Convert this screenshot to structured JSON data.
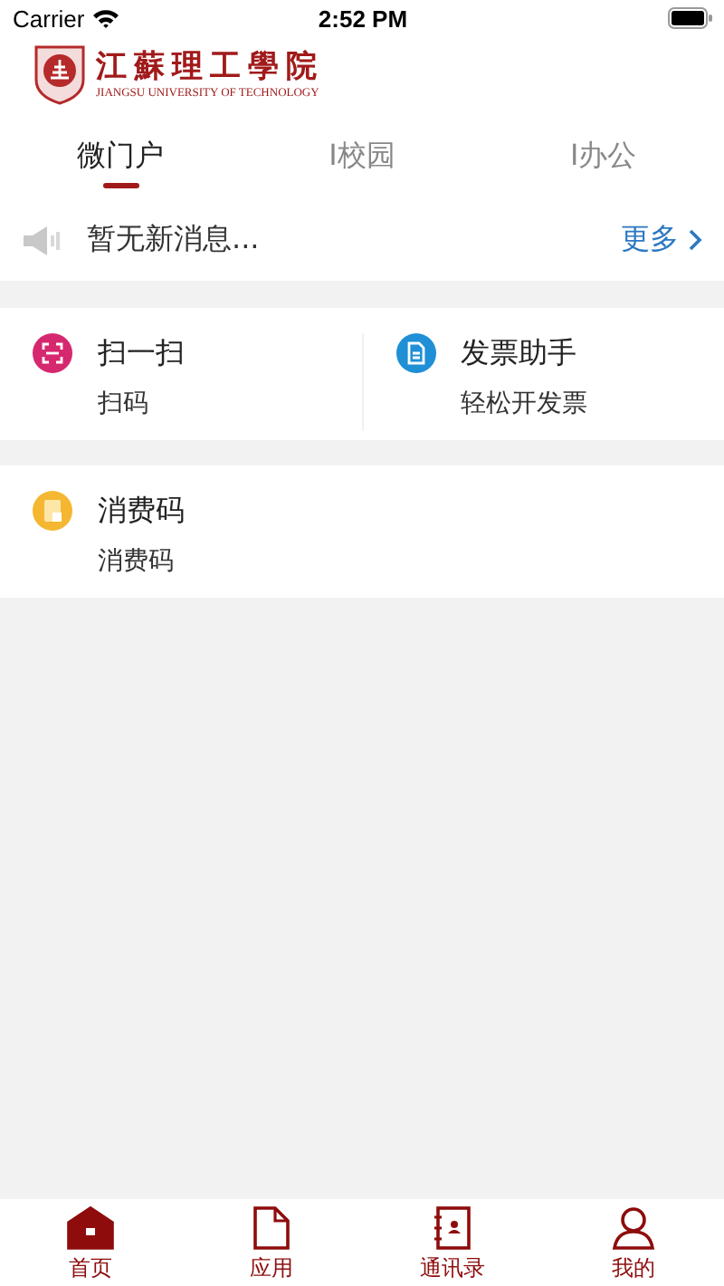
{
  "status_bar": {
    "carrier": "Carrier",
    "time": "2:52 PM"
  },
  "header": {
    "logo_name": "江蘇理工學院",
    "logo_subtitle": "JIANGSU UNIVERSITY OF TECHNOLOGY"
  },
  "tabs": [
    {
      "label": "微门户",
      "selected": true
    },
    {
      "label": "I校园",
      "selected": false
    },
    {
      "label": "I办公",
      "selected": false
    }
  ],
  "notice": {
    "text": "暂无新消息...",
    "more": "更多"
  },
  "sections": [
    {
      "items": [
        {
          "kind": "scan",
          "color": "#d6286f",
          "title": "扫一扫",
          "subtitle": "扫码"
        },
        {
          "kind": "invoice",
          "color": "#1f8fd6",
          "title": "发票助手",
          "subtitle": "轻松开发票"
        }
      ]
    },
    {
      "items": [
        {
          "kind": "payment-code",
          "color": "#f5b731",
          "title": "消费码",
          "subtitle": "消费码"
        }
      ]
    }
  ],
  "tab_bar": [
    {
      "kind": "home",
      "label": "首页",
      "selected": true
    },
    {
      "kind": "apps",
      "label": "应用",
      "selected": false
    },
    {
      "kind": "contacts",
      "label": "通讯录",
      "selected": false
    },
    {
      "kind": "profile",
      "label": "我的",
      "selected": false
    }
  ]
}
